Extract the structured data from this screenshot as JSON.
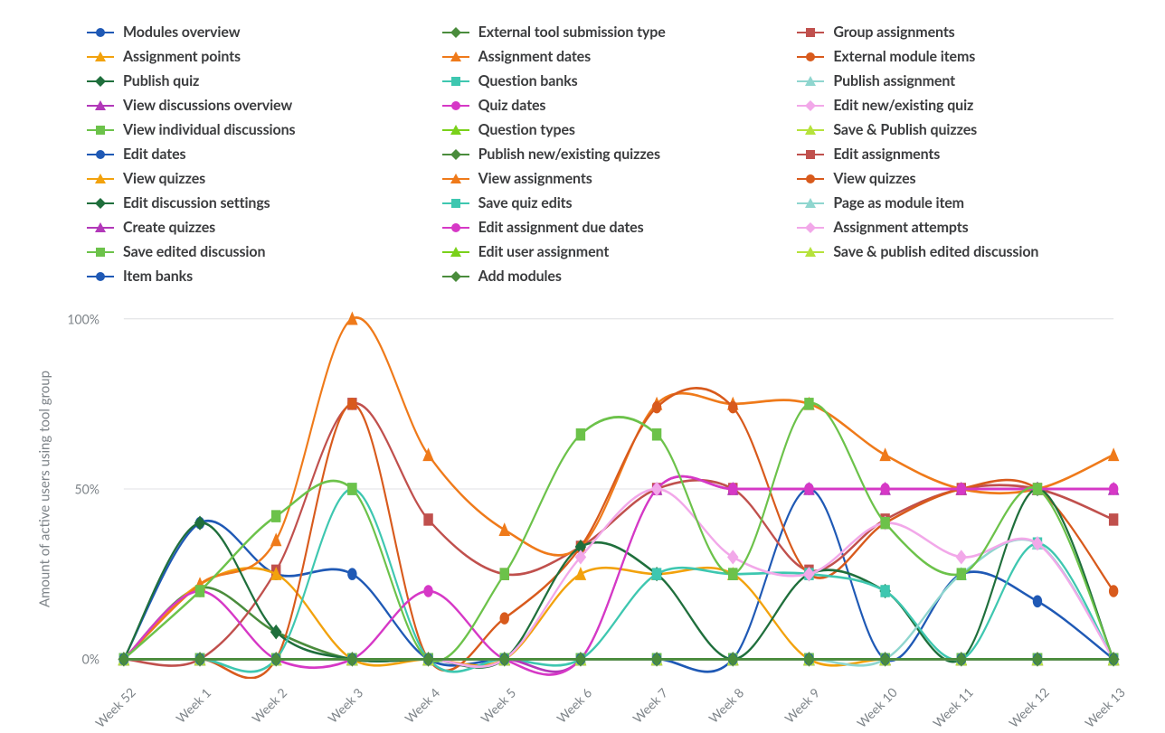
{
  "chart_data": {
    "type": "line",
    "title": "",
    "xlabel": "",
    "ylabel": "Amount of active users using tool group",
    "ylim": [
      0,
      100
    ],
    "yticks": [
      0,
      50,
      100
    ],
    "ytick_labels": [
      "0%",
      "50%",
      "100%"
    ],
    "categories": [
      "Week 52",
      "Week 1",
      "Week 2",
      "Week 3",
      "Week 4",
      "Week 5",
      "Week 6",
      "Week 7",
      "Week 8",
      "Week 9",
      "Week 10",
      "Week 11",
      "Week 12",
      "Week 13"
    ],
    "series": [
      {
        "name": "Modules overview",
        "c": 0,
        "marker": "circle",
        "color": "#1f59b5",
        "values": [
          0,
          40,
          25,
          25,
          0,
          0,
          0,
          0,
          0,
          50,
          0,
          25,
          17,
          0
        ]
      },
      {
        "name": "External tool submission type",
        "c": 1,
        "marker": "diamond",
        "color": "#4a8c3c",
        "values": [
          0,
          21,
          8,
          0,
          0,
          0,
          0,
          0,
          0,
          0,
          0,
          0,
          0,
          0
        ]
      },
      {
        "name": "Group assignments",
        "c": 2,
        "marker": "square",
        "color": "#c0504d",
        "values": [
          0,
          0,
          26,
          75,
          41,
          25,
          33,
          50,
          50,
          26,
          41,
          50,
          50,
          41
        ]
      },
      {
        "name": "Assignment points",
        "c": 0,
        "marker": "triangle",
        "color": "#f2a20d",
        "values": [
          0,
          22,
          25,
          0,
          0,
          0,
          25,
          25,
          25,
          0,
          0,
          0,
          0,
          0
        ]
      },
      {
        "name": "Assignment dates",
        "c": 1,
        "marker": "triangle",
        "color": "#ef7a1a",
        "values": [
          0,
          22,
          35,
          100,
          60,
          38,
          33,
          75,
          75,
          75,
          60,
          50,
          50,
          60
        ]
      },
      {
        "name": "External module items",
        "c": 2,
        "marker": "circle",
        "color": "#d85a1c",
        "values": [
          0,
          0,
          0,
          75,
          0,
          12,
          33,
          74,
          74,
          25,
          40,
          50,
          50,
          20
        ]
      },
      {
        "name": "Publish quiz",
        "c": 0,
        "marker": "diamond",
        "color": "#1f6f3c",
        "values": [
          0,
          40,
          8,
          0,
          0,
          0,
          33,
          25,
          0,
          25,
          20,
          0,
          50,
          0
        ]
      },
      {
        "name": "Question banks",
        "c": 1,
        "marker": "square",
        "color": "#3ec7b0",
        "values": [
          0,
          0,
          0,
          50,
          0,
          0,
          0,
          25,
          25,
          25,
          20,
          0,
          34,
          0
        ]
      },
      {
        "name": "Publish assignment",
        "c": 2,
        "marker": "triangle",
        "color": "#8fd6cf",
        "values": [
          0,
          0,
          0,
          0,
          0,
          0,
          0,
          0,
          0,
          0,
          0,
          25,
          34,
          0
        ]
      },
      {
        "name": "View discussions overview",
        "c": 0,
        "marker": "triangle",
        "color": "#b238b9",
        "values": [
          0,
          0,
          0,
          0,
          0,
          0,
          0,
          50,
          50,
          50,
          50,
          50,
          50,
          50
        ]
      },
      {
        "name": "Quiz dates",
        "c": 1,
        "marker": "circle",
        "color": "#d638c6",
        "values": [
          0,
          20,
          0,
          0,
          20,
          0,
          0,
          50,
          50,
          50,
          50,
          50,
          50,
          50
        ]
      },
      {
        "name": "Edit new/existing quiz",
        "c": 2,
        "marker": "diamond",
        "color": "#f2a8e9",
        "values": [
          0,
          0,
          0,
          0,
          0,
          0,
          30,
          50,
          30,
          25,
          40,
          30,
          34,
          0
        ]
      },
      {
        "name": "View individual discussions",
        "c": 0,
        "marker": "square",
        "color": "#6cc24a",
        "values": [
          0,
          20,
          42,
          50,
          0,
          25,
          66,
          66,
          25,
          75,
          40,
          25,
          50,
          0
        ]
      },
      {
        "name": "Question types",
        "c": 1,
        "marker": "triangle",
        "color": "#7ad11a",
        "values": [
          0,
          0,
          0,
          0,
          0,
          0,
          0,
          0,
          0,
          0,
          0,
          0,
          0,
          0
        ]
      },
      {
        "name": "Save & Publish quizzes",
        "c": 2,
        "marker": "triangle",
        "color": "#b6e23c",
        "values": [
          0,
          0,
          0,
          0,
          0,
          0,
          0,
          0,
          0,
          0,
          0,
          0,
          0,
          0
        ]
      },
      {
        "name": "Edit dates",
        "c": 0,
        "marker": "circle",
        "color": "#1f59b5",
        "values": [
          0,
          0,
          0,
          0,
          0,
          0,
          0,
          0,
          0,
          0,
          0,
          0,
          0,
          0
        ]
      },
      {
        "name": "Publish new/existing quizzes",
        "c": 1,
        "marker": "diamond",
        "color": "#4a8c3c",
        "values": [
          0,
          0,
          0,
          0,
          0,
          0,
          0,
          0,
          0,
          0,
          0,
          0,
          0,
          0
        ]
      },
      {
        "name": "Edit assignments",
        "c": 2,
        "marker": "square",
        "color": "#c0504d",
        "values": [
          0,
          0,
          0,
          0,
          0,
          0,
          0,
          0,
          0,
          0,
          0,
          0,
          0,
          0
        ]
      },
      {
        "name": "View quizzes",
        "c": 0,
        "marker": "triangle",
        "color": "#f2a20d",
        "values": [
          0,
          0,
          0,
          0,
          0,
          0,
          0,
          0,
          0,
          0,
          0,
          0,
          0,
          0
        ]
      },
      {
        "name": "View assignments",
        "c": 1,
        "marker": "triangle",
        "color": "#ef7a1a",
        "values": [
          0,
          0,
          0,
          0,
          0,
          0,
          0,
          0,
          0,
          0,
          0,
          0,
          0,
          0
        ]
      },
      {
        "name": "View quizzes",
        "c": 2,
        "marker": "circle",
        "color": "#d85a1c",
        "values": [
          0,
          0,
          0,
          0,
          0,
          0,
          0,
          0,
          0,
          0,
          0,
          0,
          0,
          0
        ]
      },
      {
        "name": "Edit discussion settings",
        "c": 0,
        "marker": "diamond",
        "color": "#1f6f3c",
        "values": [
          0,
          0,
          0,
          0,
          0,
          0,
          0,
          0,
          0,
          0,
          0,
          0,
          0,
          0
        ]
      },
      {
        "name": "Save quiz edits",
        "c": 1,
        "marker": "square",
        "color": "#3ec7b0",
        "values": [
          0,
          0,
          0,
          0,
          0,
          0,
          0,
          0,
          0,
          0,
          0,
          0,
          0,
          0
        ]
      },
      {
        "name": "Page as module item",
        "c": 2,
        "marker": "triangle",
        "color": "#8fd6cf",
        "values": [
          0,
          0,
          0,
          0,
          0,
          0,
          0,
          0,
          0,
          0,
          0,
          0,
          0,
          0
        ]
      },
      {
        "name": "Create quizzes",
        "c": 0,
        "marker": "triangle",
        "color": "#b238b9",
        "values": [
          0,
          0,
          0,
          0,
          0,
          0,
          0,
          0,
          0,
          0,
          0,
          0,
          0,
          0
        ]
      },
      {
        "name": "Edit assignment due dates",
        "c": 1,
        "marker": "circle",
        "color": "#d638c6",
        "values": [
          0,
          0,
          0,
          0,
          0,
          0,
          0,
          0,
          0,
          0,
          0,
          0,
          0,
          0
        ]
      },
      {
        "name": "Assignment attempts",
        "c": 2,
        "marker": "diamond",
        "color": "#f2a8e9",
        "values": [
          0,
          0,
          0,
          0,
          0,
          0,
          0,
          0,
          0,
          0,
          0,
          0,
          0,
          0
        ]
      },
      {
        "name": "Save edited discussion",
        "c": 0,
        "marker": "square",
        "color": "#6cc24a",
        "values": [
          0,
          0,
          0,
          0,
          0,
          0,
          0,
          0,
          0,
          0,
          0,
          0,
          0,
          0
        ]
      },
      {
        "name": "Edit user assignment",
        "c": 1,
        "marker": "triangle",
        "color": "#7ad11a",
        "values": [
          0,
          0,
          0,
          0,
          0,
          0,
          0,
          0,
          0,
          0,
          0,
          0,
          0,
          0
        ]
      },
      {
        "name": "Save & publish edited discussion",
        "c": 2,
        "marker": "triangle",
        "color": "#b6e23c",
        "values": [
          0,
          0,
          0,
          0,
          0,
          0,
          0,
          0,
          0,
          0,
          0,
          0,
          0,
          0
        ]
      },
      {
        "name": "Item banks",
        "c": 0,
        "marker": "circle",
        "color": "#1f59b5",
        "values": [
          0,
          0,
          0,
          0,
          0,
          0,
          0,
          0,
          0,
          0,
          0,
          0,
          0,
          0
        ]
      },
      {
        "name": "Add modules",
        "c": 1,
        "marker": "diamond",
        "color": "#4a8c3c",
        "values": [
          0,
          0,
          0,
          0,
          0,
          0,
          0,
          0,
          0,
          0,
          0,
          0,
          0,
          0
        ]
      }
    ]
  }
}
